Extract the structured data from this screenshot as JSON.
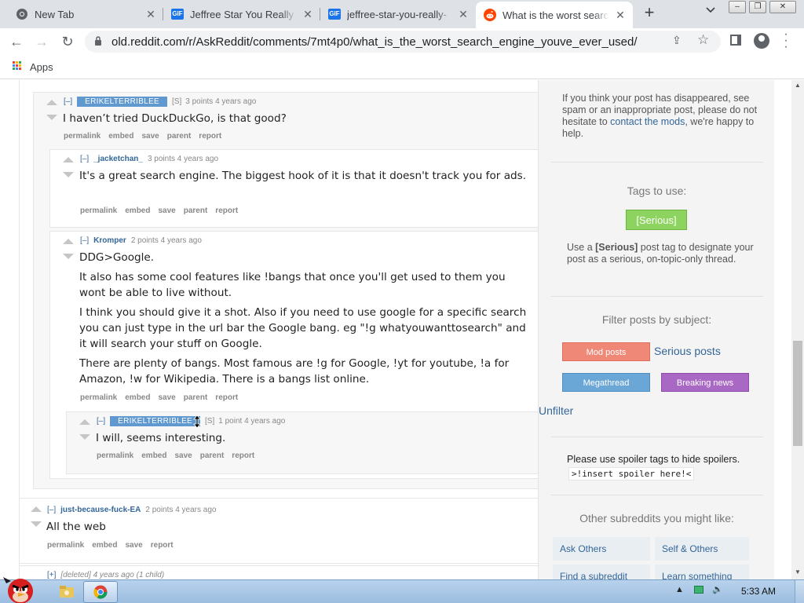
{
  "browser": {
    "tabs": [
      {
        "title": "New Tab",
        "icon": "chrome-icon",
        "active": false
      },
      {
        "title": "Jeffree Star You Really T",
        "icon": "gif-icon",
        "active": false
      },
      {
        "title": "jeffree-star-you-really-",
        "icon": "gif-icon",
        "active": false
      },
      {
        "title": "What is the worst searc",
        "icon": "reddit-icon",
        "active": true
      }
    ],
    "url": "old.reddit.com/r/AskReddit/comments/7mt4p0/what_is_the_worst_search_engine_youve_ever_used/",
    "bookmarks": {
      "apps_label": "Apps"
    },
    "gif_badge": "GIF"
  },
  "comments": {
    "top_partial": {
      "text": "— — — — — —"
    },
    "c1": {
      "expand": "[–]",
      "author": "ERIKELTERRIBLEE",
      "flag": "[S]",
      "score": "3 points",
      "time": "4 years ago",
      "body": "I haven’t tried DuckDuckGo, is that good?",
      "links": [
        "permalink",
        "embed",
        "save",
        "parent",
        "report"
      ]
    },
    "c2": {
      "expand": "[–]",
      "author": "_jacketchan_",
      "score": "3 points",
      "time": "4 years ago",
      "body": "It's a great search engine. The biggest hook of it is that it doesn't track you for ads.",
      "links": [
        "permalink",
        "embed",
        "save",
        "parent",
        "report"
      ]
    },
    "c3": {
      "expand": "[–]",
      "author": "Kromper",
      "score": "2 points",
      "time": "4 years ago",
      "paragraphs": [
        "DDG>Google.",
        "It also has some cool features like !bangs that once you'll get used to them you wont be able to live without.",
        "I think you should give it a shot. Also if you need to use google for a specific search you can just type in the url bar the Google bang. eg \"!g whatyouwanttosearch\" and it will search your stuff on Google.",
        "There are plenty of bangs. Most famous are !g for Google, !yt for youtube, !a for Amazon, !w for Wikipedia. There is a bangs list online."
      ],
      "links": [
        "permalink",
        "embed",
        "save",
        "parent",
        "report"
      ]
    },
    "c4": {
      "expand": "[–]",
      "author": "ERIKELTERRIBLEE",
      "flag": "[S]",
      "score": "1 point",
      "time": "4 years ago",
      "body": "I will, seems interesting.",
      "links": [
        "permalink",
        "embed",
        "save",
        "parent",
        "report"
      ]
    },
    "c5": {
      "expand": "[–]",
      "author": "just-because-fuck-EA",
      "score": "2 points",
      "time": "4 years ago",
      "body": "All the web",
      "links": [
        "permalink",
        "embed",
        "save",
        "report"
      ]
    },
    "c6": {
      "expand": "[+]",
      "author": "[deleted]",
      "time": "4 years ago",
      "children": "(1 child)"
    }
  },
  "sidebar": {
    "disappeared_pre": "If you think your post has disappeared, see spam or an inappropriate post, please do not hesitate to ",
    "contact_link": "contact the mods",
    "disappeared_post": ", we're happy to help.",
    "tags_heading": "Tags to use:",
    "serious_tag": "[Serious]",
    "serious_desc_pre": "Use a ",
    "serious_desc_tag": "[Serious]",
    "serious_desc_post": " post tag to designate your post as a serious, on-topic-only thread.",
    "filter_heading": "Filter posts by subject:",
    "filters": {
      "mod_posts": "Mod posts",
      "serious_posts": "Serious posts",
      "megathread": "Megathread",
      "breaking_news": "Breaking news",
      "unfilter": "Unfilter"
    },
    "spoiler_text": "Please use spoiler tags to hide spoilers.",
    "spoiler_code": ">!insert spoiler here!<",
    "other_heading": "Other subreddits you might like:",
    "other_links": [
      "Ask Others",
      "Self & Others",
      "Find a subreddit",
      "Learn something"
    ]
  },
  "colors": {
    "op_author_bg": "#5f99cf",
    "serious_tag_bg": "#8dd35f",
    "mod_posts_bg": "#f08878",
    "megathread_bg": "#6aa6d6",
    "breaking_news_bg": "#a868c4",
    "link_blue": "#336699"
  },
  "taskbar": {
    "clock": "5:33 AM"
  }
}
